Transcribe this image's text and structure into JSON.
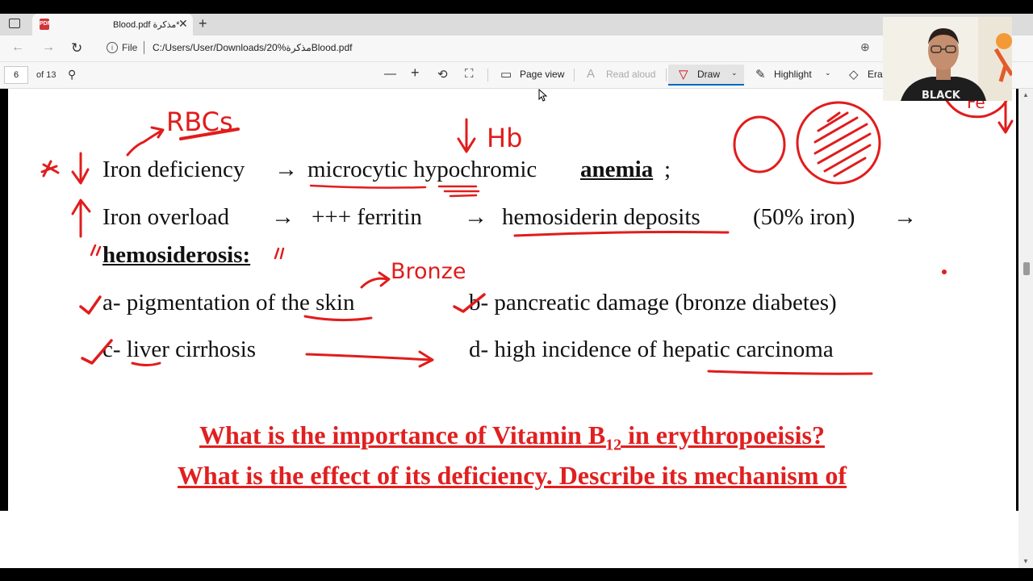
{
  "browser": {
    "tab_title": "Blood.pdf مذكرة*",
    "tab_icon": "pdf-icon",
    "file_label": "File",
    "url": "C:/Users/User/Downloads/20%مذكرةBlood.pdf"
  },
  "pdf_toolbar": {
    "page_number": "6",
    "page_total": "of 13",
    "page_view": "Page view",
    "read_aloud": "Read aloud",
    "draw": "Draw",
    "highlight": "Highlight",
    "erase": "Eras"
  },
  "document": {
    "line1_a": "Iron deficiency",
    "line1_b": "microcytic hypochromic",
    "line1_c": "anemia",
    "line1_d": ";",
    "line2_a": "Iron  overload",
    "line2_b": "+++  ferritin",
    "line2_c": "hemosiderin  deposits",
    "line2_d": "(50%  iron)",
    "line3": "hemosiderosis:",
    "item_a": "a- pigmentation of the skin",
    "item_b": "b- pancreatic damage (bronze diabetes)",
    "item_c": "c- liver cirrhosis",
    "item_d": "d- high incidence of hepatic carcinoma",
    "question1_a": "What is the importance of Vitamin B",
    "question1_sub": "12",
    "question1_b": " in erythropoeisis?",
    "question2": "What is the effect of its deficiency. Describe its mechanism of",
    "arrow": "→"
  },
  "annotations": {
    "rbcs": "RBCs",
    "hb": "Hb",
    "bronze": "Bronze",
    "fe": "Fe",
    "ink_color": "#e11c1c"
  },
  "webcam": {
    "shirt_text": "BLACK"
  }
}
